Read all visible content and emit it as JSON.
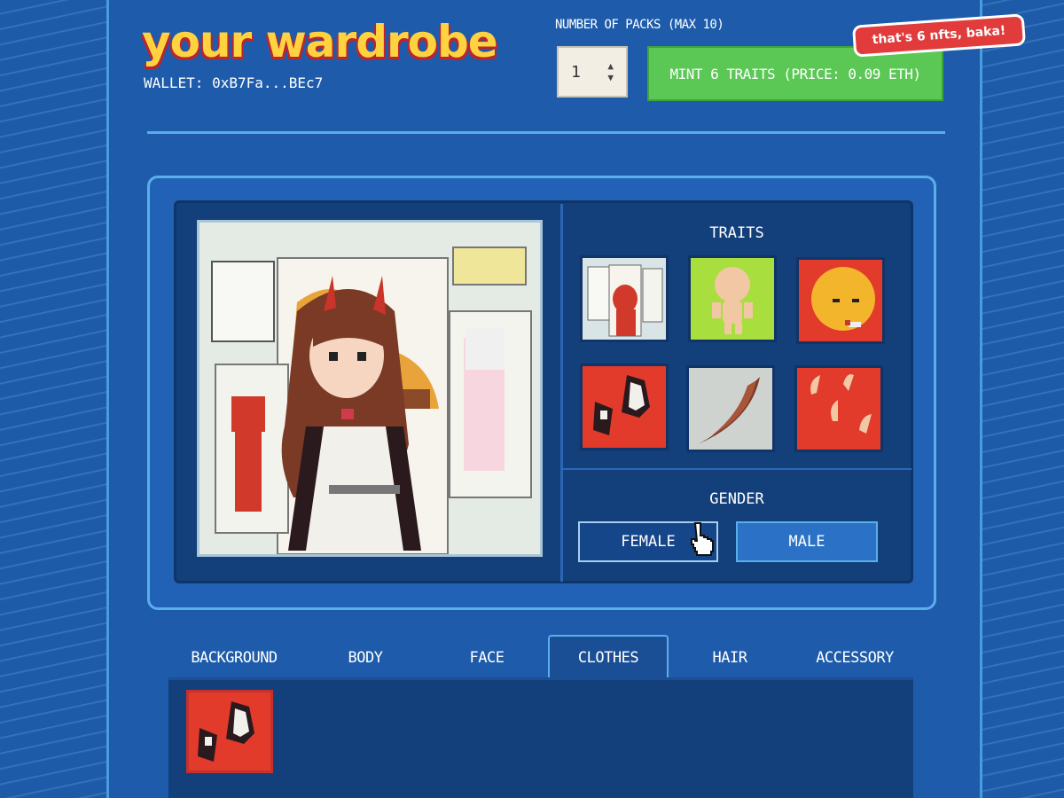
{
  "header": {
    "title": "your wardrobe",
    "wallet": "WALLET: 0xB7Fa...BEc7",
    "packs_label": "NUMBER OF PACKS (MAX 10)",
    "packs_value": "1",
    "mint_button": "MINT 6 TRAITS (PRICE: 0.09 ETH)",
    "sticker": "that's 6 nfts, baka!"
  },
  "traits": {
    "title": "TRAITS",
    "tiles": [
      {
        "name": "background",
        "color": "#d9e4e6"
      },
      {
        "name": "body",
        "color": "#a9de3f"
      },
      {
        "name": "face",
        "color": "#e23b2b"
      },
      {
        "name": "clothes",
        "color": "#e23b2b"
      },
      {
        "name": "hair",
        "color": "#cfd3d0"
      },
      {
        "name": "accessory",
        "color": "#e23b2b"
      }
    ]
  },
  "gender": {
    "title": "GENDER",
    "options": [
      "FEMALE",
      "MALE"
    ],
    "selected": "FEMALE"
  },
  "tabs": {
    "items": [
      "BACKGROUND",
      "BODY",
      "FACE",
      "CLOTHES",
      "HAIR",
      "ACCESSORY"
    ],
    "active": "CLOTHES"
  },
  "colors": {
    "accent_green": "#5bc855",
    "title_yellow": "#ffd23f",
    "sticker_red": "#e23b3b",
    "panel_blue": "#1e5cab"
  }
}
